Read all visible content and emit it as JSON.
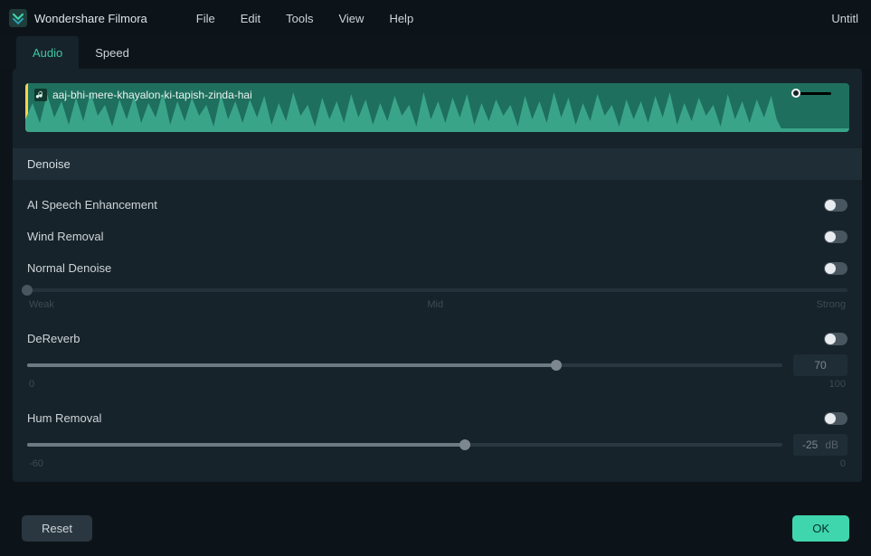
{
  "app": {
    "title": "Wondershare Filmora",
    "document": "Untitl"
  },
  "menu": {
    "file": "File",
    "edit": "Edit",
    "tools": "Tools",
    "view": "View",
    "help": "Help"
  },
  "tabs": {
    "audio": "Audio",
    "speed": "Speed"
  },
  "clip": {
    "name": "aaj-bhi-mere-khayalon-ki-tapish-zinda-hai"
  },
  "section": {
    "denoise": "Denoise"
  },
  "denoise": {
    "ai_speech": {
      "label": "AI Speech Enhancement",
      "on": false
    },
    "wind": {
      "label": "Wind Removal",
      "on": false
    },
    "normal": {
      "label": "Normal Denoise",
      "on": false,
      "value_pct": 0,
      "scale": {
        "min": "Weak",
        "mid": "Mid",
        "max": "Strong"
      }
    },
    "dereverb": {
      "label": "DeReverb",
      "on": false,
      "value": "70",
      "value_pct": 70,
      "scale": {
        "min": "0",
        "max": "100"
      }
    },
    "hum": {
      "label": "Hum Removal",
      "on": false,
      "value": "-25",
      "unit": "dB",
      "value_pct": 58,
      "scale": {
        "min": "-60",
        "max": "0"
      }
    }
  },
  "buttons": {
    "reset": "Reset",
    "ok": "OK"
  },
  "colors": {
    "accent": "#3fd6ae",
    "clip_bg": "#1e6f5e"
  }
}
